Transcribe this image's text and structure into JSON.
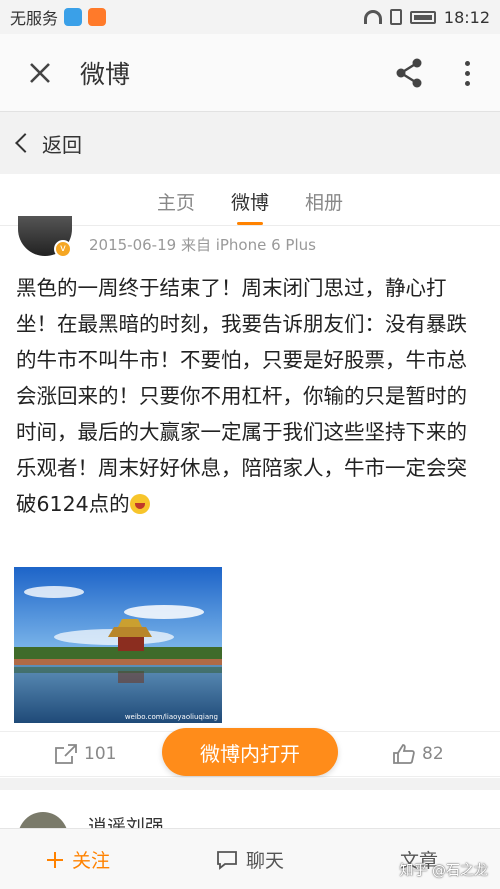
{
  "status_bar": {
    "carrier": "无服务",
    "time": "18:12"
  },
  "app_bar": {
    "title": "微博"
  },
  "back_bar": {
    "label": "返回"
  },
  "tabs": [
    {
      "label": "主页",
      "active": false
    },
    {
      "label": "微博",
      "active": true
    },
    {
      "label": "相册",
      "active": false
    }
  ],
  "post": {
    "meta": "2015-06-19 来自 iPhone 6 Plus",
    "text": "黑色的一周终于结束了！周末闭门思过，静心打坐！在最黑暗的时刻，我要告诉朋友们：没有暴跌的牛市不叫牛市！不要怕，只要是好股票，牛市总会涨回来的！只要你不用杠杆，你输的只是暂时的时间，最后的大赢家一定属于我们这些坚持下来的乐观者！周末好好休息，陪陪家人，牛市一定会突破6124点的",
    "image_watermark": "weibo.com/liaoyaoliuqiang",
    "repost_count": "101",
    "like_count": "82",
    "open_button": "微博内打开"
  },
  "next_post": {
    "name": "逍遥刘强"
  },
  "bottom_bar": {
    "follow": "关注",
    "chat": "聊天",
    "article": "文章"
  },
  "watermark": "知乎 @石之龙",
  "colors": {
    "accent": "#ff8200",
    "open_button": "#ff8c1a"
  }
}
